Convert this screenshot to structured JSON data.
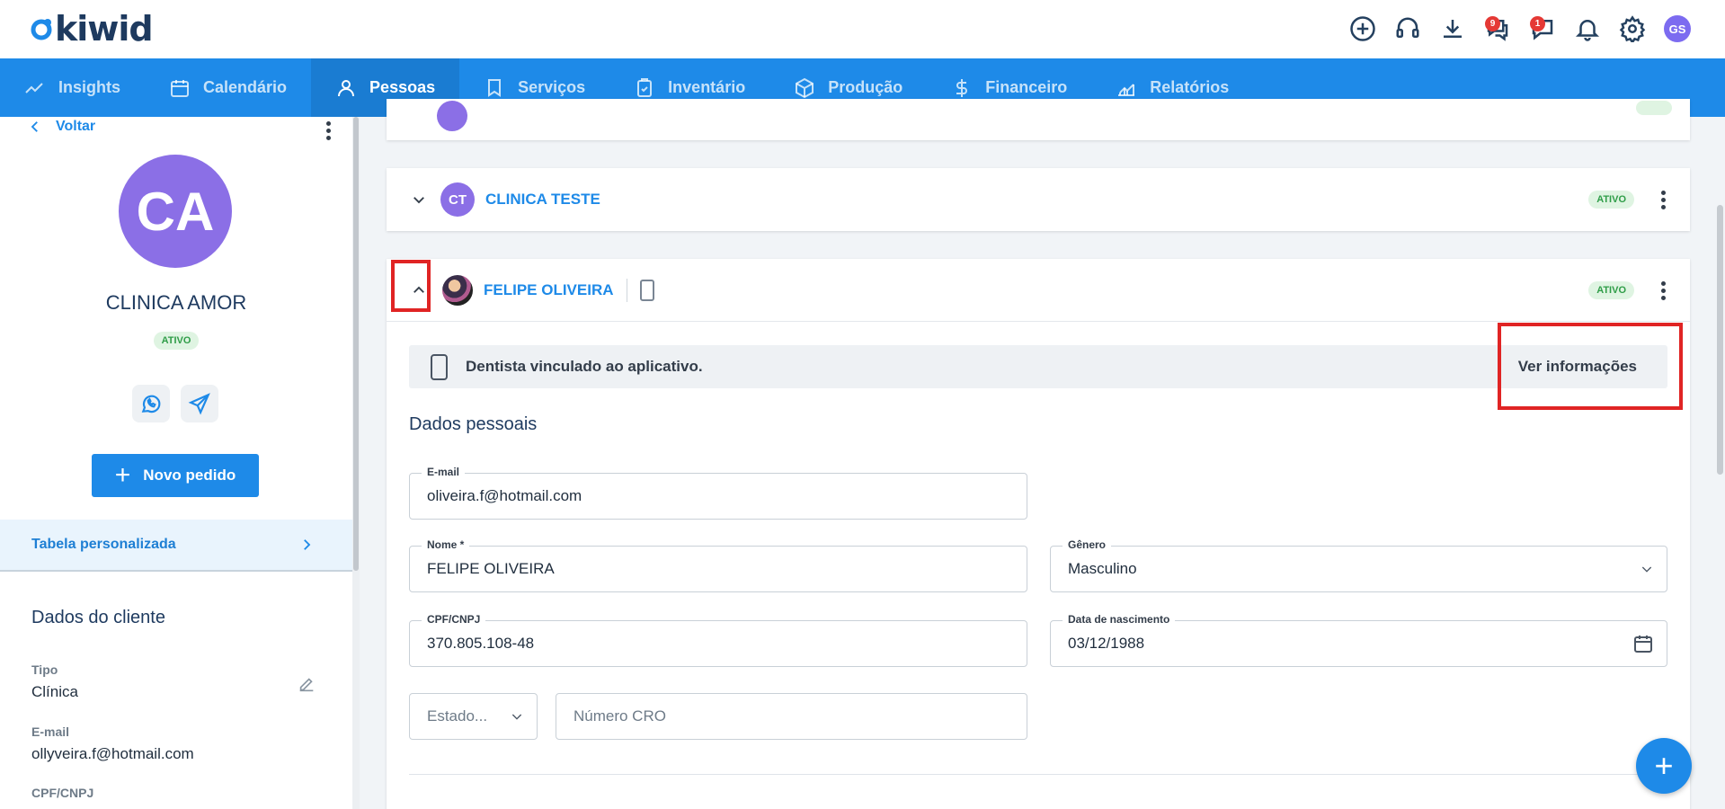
{
  "app": {
    "logo_text": "kiwid"
  },
  "topbar": {
    "icons": [
      "plus-circle-icon",
      "headset-icon",
      "download-icon",
      "chat-icon",
      "chat-icon",
      "bell-icon",
      "gear-icon"
    ],
    "chat_badge_1": "9",
    "chat_badge_2": "1",
    "user_initials": "GS"
  },
  "nav": {
    "items": [
      {
        "label": "Insights",
        "icon": "trend-icon"
      },
      {
        "label": "Calendário",
        "icon": "calendar-icon"
      },
      {
        "label": "Pessoas",
        "icon": "person-icon",
        "active": true
      },
      {
        "label": "Serviços",
        "icon": "tooth-icon"
      },
      {
        "label": "Inventário",
        "icon": "clipboard-icon"
      },
      {
        "label": "Produção",
        "icon": "box-icon"
      },
      {
        "label": "Financeiro",
        "icon": "dollar-icon"
      },
      {
        "label": "Relatórios",
        "icon": "chart-icon"
      }
    ]
  },
  "left": {
    "back_label": "Voltar",
    "avatar_initials": "CA",
    "client_name": "CLINICA AMOR",
    "status": "ATIVO",
    "new_order_label": "Novo pedido",
    "tabela_label": "Tabela personalizada",
    "section_title": "Dados do cliente",
    "tipo_label": "Tipo",
    "tipo_value": "Clínica",
    "email_label": "E-mail",
    "email_value": "ollyveira.f@hotmail.com",
    "cpf_label": "CPF/CNPJ"
  },
  "cards": {
    "ct_initials": "CT",
    "ct_name": "CLINICA TESTE",
    "ct_status": "ATIVO",
    "felipe_name": "FELIPE OLIVEIRA",
    "felipe_status": "ATIVO"
  },
  "detail": {
    "app_notice": "Dentista vinculado ao aplicativo.",
    "ver_info_label": "Ver informações",
    "section_title": "Dados pessoais",
    "email_label": "E-mail",
    "email_value": "oliveira.f@hotmail.com",
    "nome_label": "Nome *",
    "nome_value": "FELIPE OLIVEIRA",
    "genero_label": "Gênero",
    "genero_value": "Masculino",
    "cpf_label": "CPF/CNPJ",
    "cpf_value": "370.805.108-48",
    "nasc_label": "Data de nascimento",
    "nasc_value": "03/12/1988",
    "estado_placeholder": "Estado...",
    "cro_placeholder": "Número CRO"
  },
  "colors": {
    "primary": "#1e8ae8",
    "avatar": "#8b6fe6",
    "highlight": "#e02424",
    "status_green": "#2f9d48"
  }
}
